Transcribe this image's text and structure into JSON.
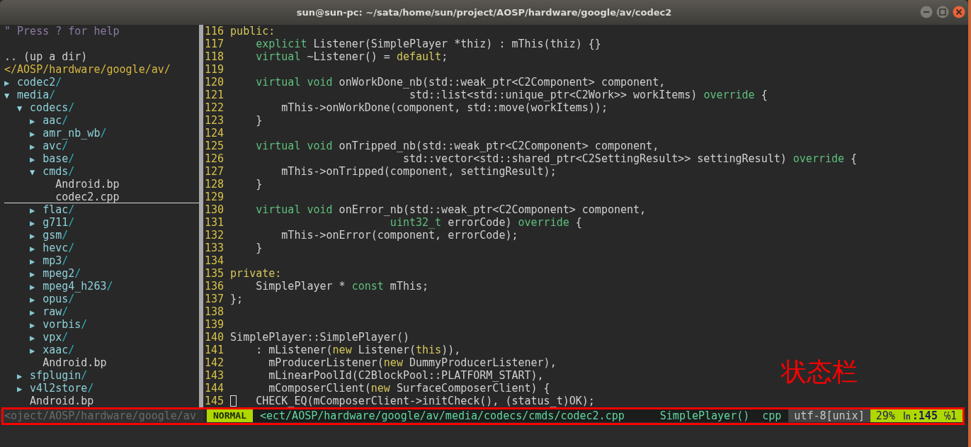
{
  "window": {
    "title": "sun@sun-pc: ~/sata/home/sun/project/AOSP/hardware/google/av/codec2"
  },
  "tree": {
    "help": "\" Press ? for help",
    "up": ".. (up a dir)",
    "root": "</AOSP/hardware/google/av/",
    "items": [
      {
        "name": "codec2/",
        "kind": "dir",
        "marker": "▶",
        "expanded": false,
        "selected": false
      },
      {
        "name": "media/",
        "kind": "dir",
        "marker": "▼",
        "expanded": true,
        "selected": false,
        "children": [
          {
            "name": "codecs/",
            "kind": "dir",
            "marker": "▼",
            "expanded": true,
            "selected": false,
            "children": [
              {
                "name": "aac/",
                "kind": "dir",
                "marker": "▶",
                "expanded": false,
                "selected": false
              },
              {
                "name": "amr_nb_wb/",
                "kind": "dir",
                "marker": "▶",
                "expanded": false,
                "selected": false
              },
              {
                "name": "avc/",
                "kind": "dir",
                "marker": "▶",
                "expanded": false,
                "selected": false
              },
              {
                "name": "base/",
                "kind": "dir",
                "marker": "▶",
                "expanded": false,
                "selected": false
              },
              {
                "name": "cmds/",
                "kind": "dir",
                "marker": "▼",
                "expanded": true,
                "selected": false,
                "children": [
                  {
                    "name": "Android.bp",
                    "kind": "file",
                    "selected": false
                  },
                  {
                    "name": "codec2.cpp",
                    "kind": "file",
                    "selected": true
                  }
                ]
              },
              {
                "name": "flac/",
                "kind": "dir",
                "marker": "▶",
                "expanded": false,
                "selected": false
              },
              {
                "name": "g711/",
                "kind": "dir",
                "marker": "▶",
                "expanded": false,
                "selected": false
              },
              {
                "name": "gsm/",
                "kind": "dir",
                "marker": "▶",
                "expanded": false,
                "selected": false
              },
              {
                "name": "hevc/",
                "kind": "dir",
                "marker": "▶",
                "expanded": false,
                "selected": false
              },
              {
                "name": "mp3/",
                "kind": "dir",
                "marker": "▶",
                "expanded": false,
                "selected": false
              },
              {
                "name": "mpeg2/",
                "kind": "dir",
                "marker": "▶",
                "expanded": false,
                "selected": false
              },
              {
                "name": "mpeg4_h263/",
                "kind": "dir",
                "marker": "▶",
                "expanded": false,
                "selected": false
              },
              {
                "name": "opus/",
                "kind": "dir",
                "marker": "▶",
                "expanded": false,
                "selected": false
              },
              {
                "name": "raw/",
                "kind": "dir",
                "marker": "▶",
                "expanded": false,
                "selected": false
              },
              {
                "name": "vorbis/",
                "kind": "dir",
                "marker": "▶",
                "expanded": false,
                "selected": false
              },
              {
                "name": "vpx/",
                "kind": "dir",
                "marker": "▶",
                "expanded": false,
                "selected": false
              },
              {
                "name": "xaac/",
                "kind": "dir",
                "marker": "▶",
                "expanded": false,
                "selected": false
              },
              {
                "name": "Android.bp",
                "kind": "file",
                "selected": false
              }
            ]
          },
          {
            "name": "sfplugin/",
            "kind": "dir",
            "marker": "▶",
            "expanded": false,
            "selected": false
          },
          {
            "name": "v4l2store/",
            "kind": "dir",
            "marker": "▶",
            "expanded": false,
            "selected": false
          },
          {
            "name": "Android.bp",
            "kind": "file",
            "selected": false
          }
        ]
      }
    ]
  },
  "code": {
    "lines": [
      {
        "number": "116",
        "segments": [
          {
            "kind": "keyword",
            "text": "public:"
          }
        ]
      },
      {
        "number": "117",
        "segments": [
          {
            "kind": "type",
            "text": "    explicit"
          },
          {
            "kind": "plain",
            "text": " Listener(SimplePlayer *thiz) : mThis(thiz) {}"
          }
        ]
      },
      {
        "number": "118",
        "segments": [
          {
            "kind": "type",
            "text": "    virtual"
          },
          {
            "kind": "plain",
            "text": " ~Listener() = "
          },
          {
            "kind": "keyword",
            "text": "default"
          },
          {
            "kind": "plain",
            "text": ";"
          }
        ]
      },
      {
        "number": "119"
      },
      {
        "number": "120",
        "segments": [
          {
            "kind": "type",
            "text": "    virtual void"
          },
          {
            "kind": "plain",
            "text": " onWorkDone_nb(std::weak_ptr<C2Component> component,"
          }
        ]
      },
      {
        "number": "121",
        "segments": [
          {
            "kind": "plain",
            "text": "                            std::list<std::unique_ptr<C2Work>> workItems) "
          },
          {
            "kind": "type",
            "text": "override"
          },
          {
            "kind": "plain",
            "text": " {"
          }
        ]
      },
      {
        "number": "122",
        "segments": [
          {
            "kind": "plain",
            "text": "        mThis->onWorkDone(component, std::move(workItems));"
          }
        ]
      },
      {
        "number": "123",
        "segments": [
          {
            "kind": "plain",
            "text": "    }"
          }
        ]
      },
      {
        "number": "124"
      },
      {
        "number": "125",
        "segments": [
          {
            "kind": "type",
            "text": "    virtual void"
          },
          {
            "kind": "plain",
            "text": " onTripped_nb(std::weak_ptr<C2Component> component,"
          }
        ]
      },
      {
        "number": "126",
        "segments": [
          {
            "kind": "plain",
            "text": "                           std::vector<std::shared_ptr<C2SettingResult>> settingResult) "
          },
          {
            "kind": "type",
            "text": "override"
          },
          {
            "kind": "plain",
            "text": " {"
          }
        ]
      },
      {
        "number": "127",
        "segments": [
          {
            "kind": "plain",
            "text": "        mThis->onTripped(component, settingResult);"
          }
        ]
      },
      {
        "number": "128",
        "segments": [
          {
            "kind": "plain",
            "text": "    }"
          }
        ]
      },
      {
        "number": "129"
      },
      {
        "number": "130",
        "segments": [
          {
            "kind": "type",
            "text": "    virtual void"
          },
          {
            "kind": "plain",
            "text": " onError_nb(std::weak_ptr<C2Component> component,"
          }
        ]
      },
      {
        "number": "131",
        "segments": [
          {
            "kind": "type",
            "text": "                         uint32_t"
          },
          {
            "kind": "plain",
            "text": " errorCode) "
          },
          {
            "kind": "type",
            "text": "override"
          },
          {
            "kind": "plain",
            "text": " {"
          }
        ]
      },
      {
        "number": "132",
        "segments": [
          {
            "kind": "plain",
            "text": "        mThis->onError(component, errorCode);"
          }
        ]
      },
      {
        "number": "133",
        "segments": [
          {
            "kind": "plain",
            "text": "    }"
          }
        ]
      },
      {
        "number": "134"
      },
      {
        "number": "135",
        "segments": [
          {
            "kind": "keyword",
            "text": "private:"
          }
        ]
      },
      {
        "number": "136",
        "segments": [
          {
            "kind": "plain",
            "text": "    SimplePlayer * "
          },
          {
            "kind": "type",
            "text": "const"
          },
          {
            "kind": "plain",
            "text": " mThis;"
          }
        ]
      },
      {
        "number": "137",
        "segments": [
          {
            "kind": "plain",
            "text": "};"
          }
        ]
      },
      {
        "number": "138"
      },
      {
        "number": "139"
      },
      {
        "number": "140",
        "segments": [
          {
            "kind": "plain",
            "text": "SimplePlayer::SimplePlayer()"
          }
        ]
      },
      {
        "number": "141",
        "segments": [
          {
            "kind": "plain",
            "text": "    : mListener("
          },
          {
            "kind": "keyword",
            "text": "new"
          },
          {
            "kind": "plain",
            "text": " Listener("
          },
          {
            "kind": "keyword",
            "text": "this"
          },
          {
            "kind": "plain",
            "text": ")),"
          }
        ]
      },
      {
        "number": "142",
        "segments": [
          {
            "kind": "plain",
            "text": "      mProducerListener("
          },
          {
            "kind": "keyword",
            "text": "new"
          },
          {
            "kind": "plain",
            "text": " DummyProducerListener),"
          }
        ]
      },
      {
        "number": "143",
        "segments": [
          {
            "kind": "plain",
            "text": "      mLinearPoolId(C2BlockPool::PLATFORM_START),"
          }
        ]
      },
      {
        "number": "144",
        "segments": [
          {
            "kind": "plain",
            "text": "      mComposerClient("
          },
          {
            "kind": "keyword",
            "text": "new"
          },
          {
            "kind": "plain",
            "text": " SurfaceComposerClient) {"
          }
        ]
      },
      {
        "number": "145",
        "cursor": true,
        "segments": [
          {
            "kind": "plain",
            "text": "   CHECK_EQ(mComposerClient->initCheck(), (status_t)OK);"
          }
        ]
      }
    ]
  },
  "status_bar": {
    "tree_path": "<oject/AOSP/hardware/google/av",
    "mode": "NORMAL",
    "file_path": "<ect/AOSP/hardware/google/av/media/codecs/cmds/codec2.cpp",
    "function": "SimplePlayer()",
    "filetype": "cpp",
    "encoding": "utf-8[unix]",
    "percent": "29%",
    "line": "㏑:145",
    "column": "℅1"
  },
  "annotation": {
    "label": "状态栏"
  }
}
